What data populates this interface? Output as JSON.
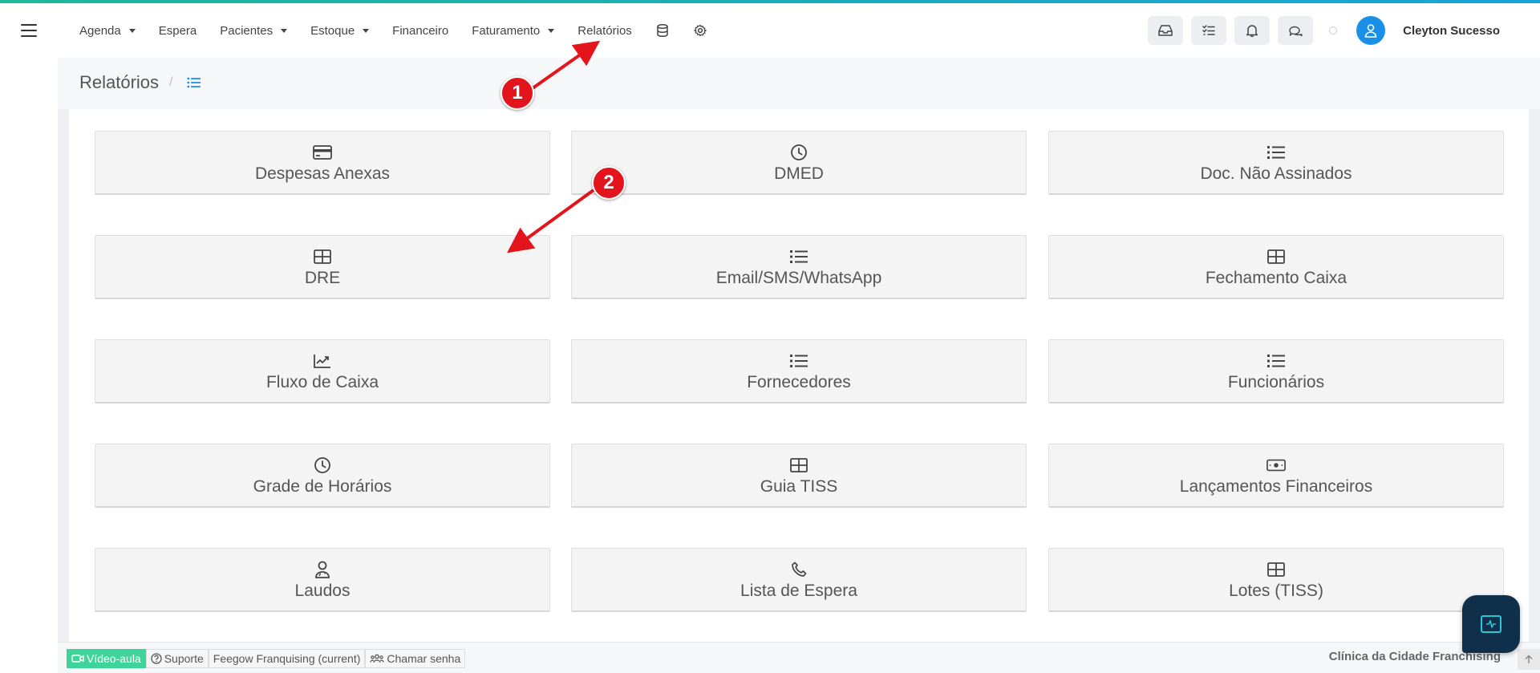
{
  "colors": {
    "accent": "#1a8fe8",
    "annotation": "#e3141b",
    "video_button": "#3fd59a",
    "topline_start": "#1fb89a",
    "topline_end": "#17a2d8"
  },
  "nav": {
    "menu_icon": "hamburger-icon",
    "items": [
      {
        "label": "Agenda",
        "dropdown": true
      },
      {
        "label": "Espera",
        "dropdown": false
      },
      {
        "label": "Pacientes",
        "dropdown": true
      },
      {
        "label": "Estoque",
        "dropdown": true
      },
      {
        "label": "Financeiro",
        "dropdown": false
      },
      {
        "label": "Faturamento",
        "dropdown": true
      },
      {
        "label": "Relatórios",
        "dropdown": false
      }
    ],
    "extra_icons": [
      "database-icon",
      "gear-icon"
    ],
    "tools": [
      "inbox-icon",
      "checklist-icon",
      "bell-icon",
      "chat-icon"
    ],
    "user_name": "Cleyton Sucesso"
  },
  "page": {
    "title": "Relatórios",
    "breadcrumb_separator": "/"
  },
  "cards": [
    {
      "label": "Despesas Anexas",
      "icon": "credit-card-icon"
    },
    {
      "label": "DMED",
      "icon": "clock-icon"
    },
    {
      "label": "Doc. Não Assinados",
      "icon": "list-icon"
    },
    {
      "label": "DRE",
      "icon": "table-icon"
    },
    {
      "label": "Email/SMS/WhatsApp",
      "icon": "list-icon"
    },
    {
      "label": "Fechamento Caixa",
      "icon": "table-icon"
    },
    {
      "label": "Fluxo de Caixa",
      "icon": "chart-line-icon"
    },
    {
      "label": "Fornecedores",
      "icon": "list-icon"
    },
    {
      "label": "Funcionários",
      "icon": "list-icon"
    },
    {
      "label": "Grade de Horários",
      "icon": "clock-icon"
    },
    {
      "label": "Guia TISS",
      "icon": "table-icon"
    },
    {
      "label": "Lançamentos Financeiros",
      "icon": "money-icon"
    },
    {
      "label": "Laudos",
      "icon": "user-doctor-icon"
    },
    {
      "label": "Lista de Espera",
      "icon": "phone-icon"
    },
    {
      "label": "Lotes (TISS)",
      "icon": "table-icon"
    }
  ],
  "annotations": {
    "step1": "1",
    "step2": "2"
  },
  "footer": {
    "video_label": "Vídeo-aula",
    "support_label": "Suporte",
    "company_label": "Feegow Franquising (current)",
    "call_label": "Chamar senha",
    "clinic_name": "Clínica da Cidade Franchising"
  }
}
